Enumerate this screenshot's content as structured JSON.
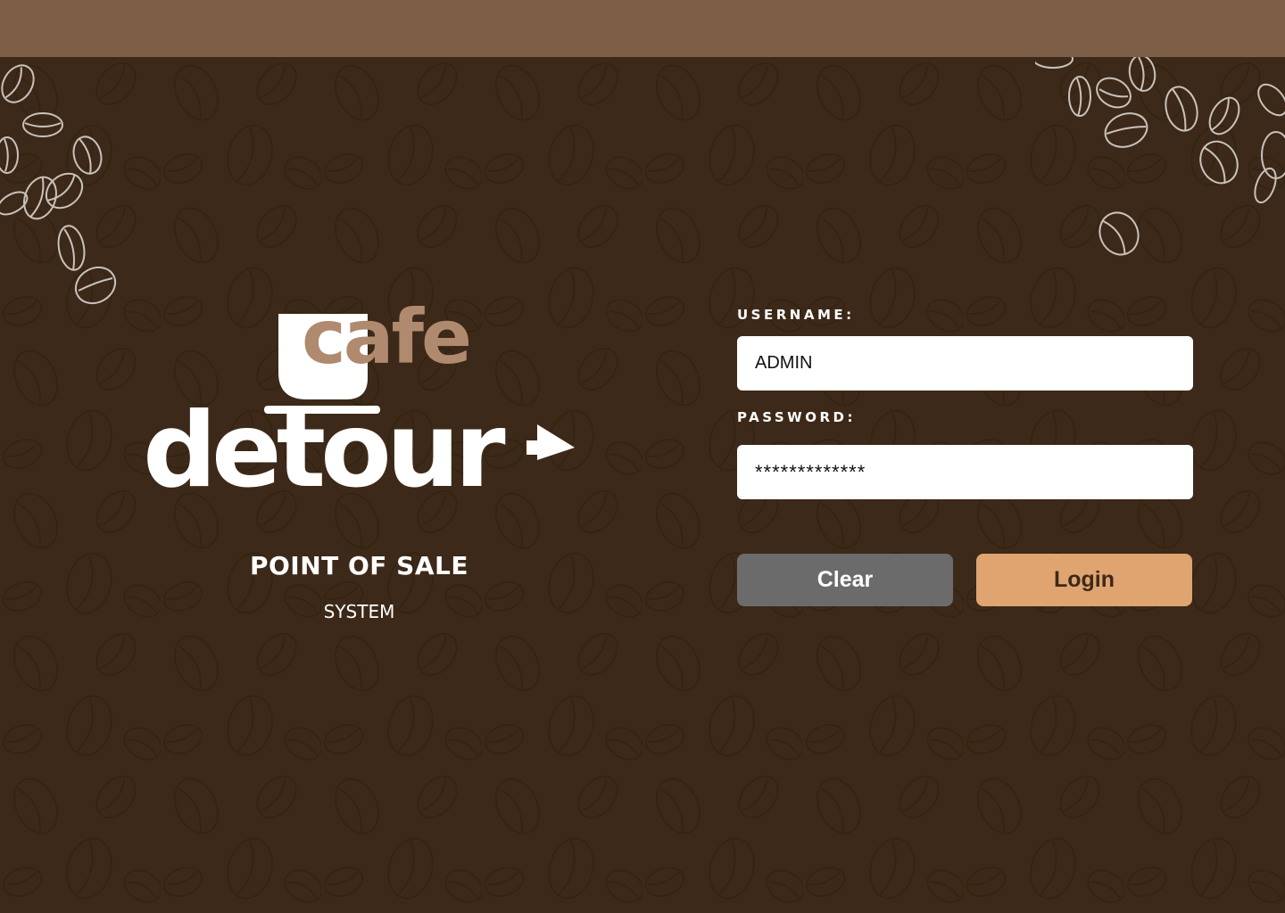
{
  "app": {
    "logo_text_top": "cafe",
    "logo_text_main": "detour",
    "title": "POINT OF SALE",
    "subtitle": "SYSTEM"
  },
  "login_form": {
    "username_label": "USERNAME:",
    "username_value": "ADMIN",
    "password_label": "PASSWORD:",
    "password_value": "*************",
    "clear_label": "Clear",
    "login_label": "Login"
  },
  "icons": {
    "logo": "cafe-detour-logo",
    "background": "coffee-bean-pattern"
  },
  "colors": {
    "background": "#3d2919",
    "top_bar": "#7d5f48",
    "logo_accent": "#b08a6e",
    "clear_button": "#6b6b6b",
    "login_button": "#e0a470"
  }
}
